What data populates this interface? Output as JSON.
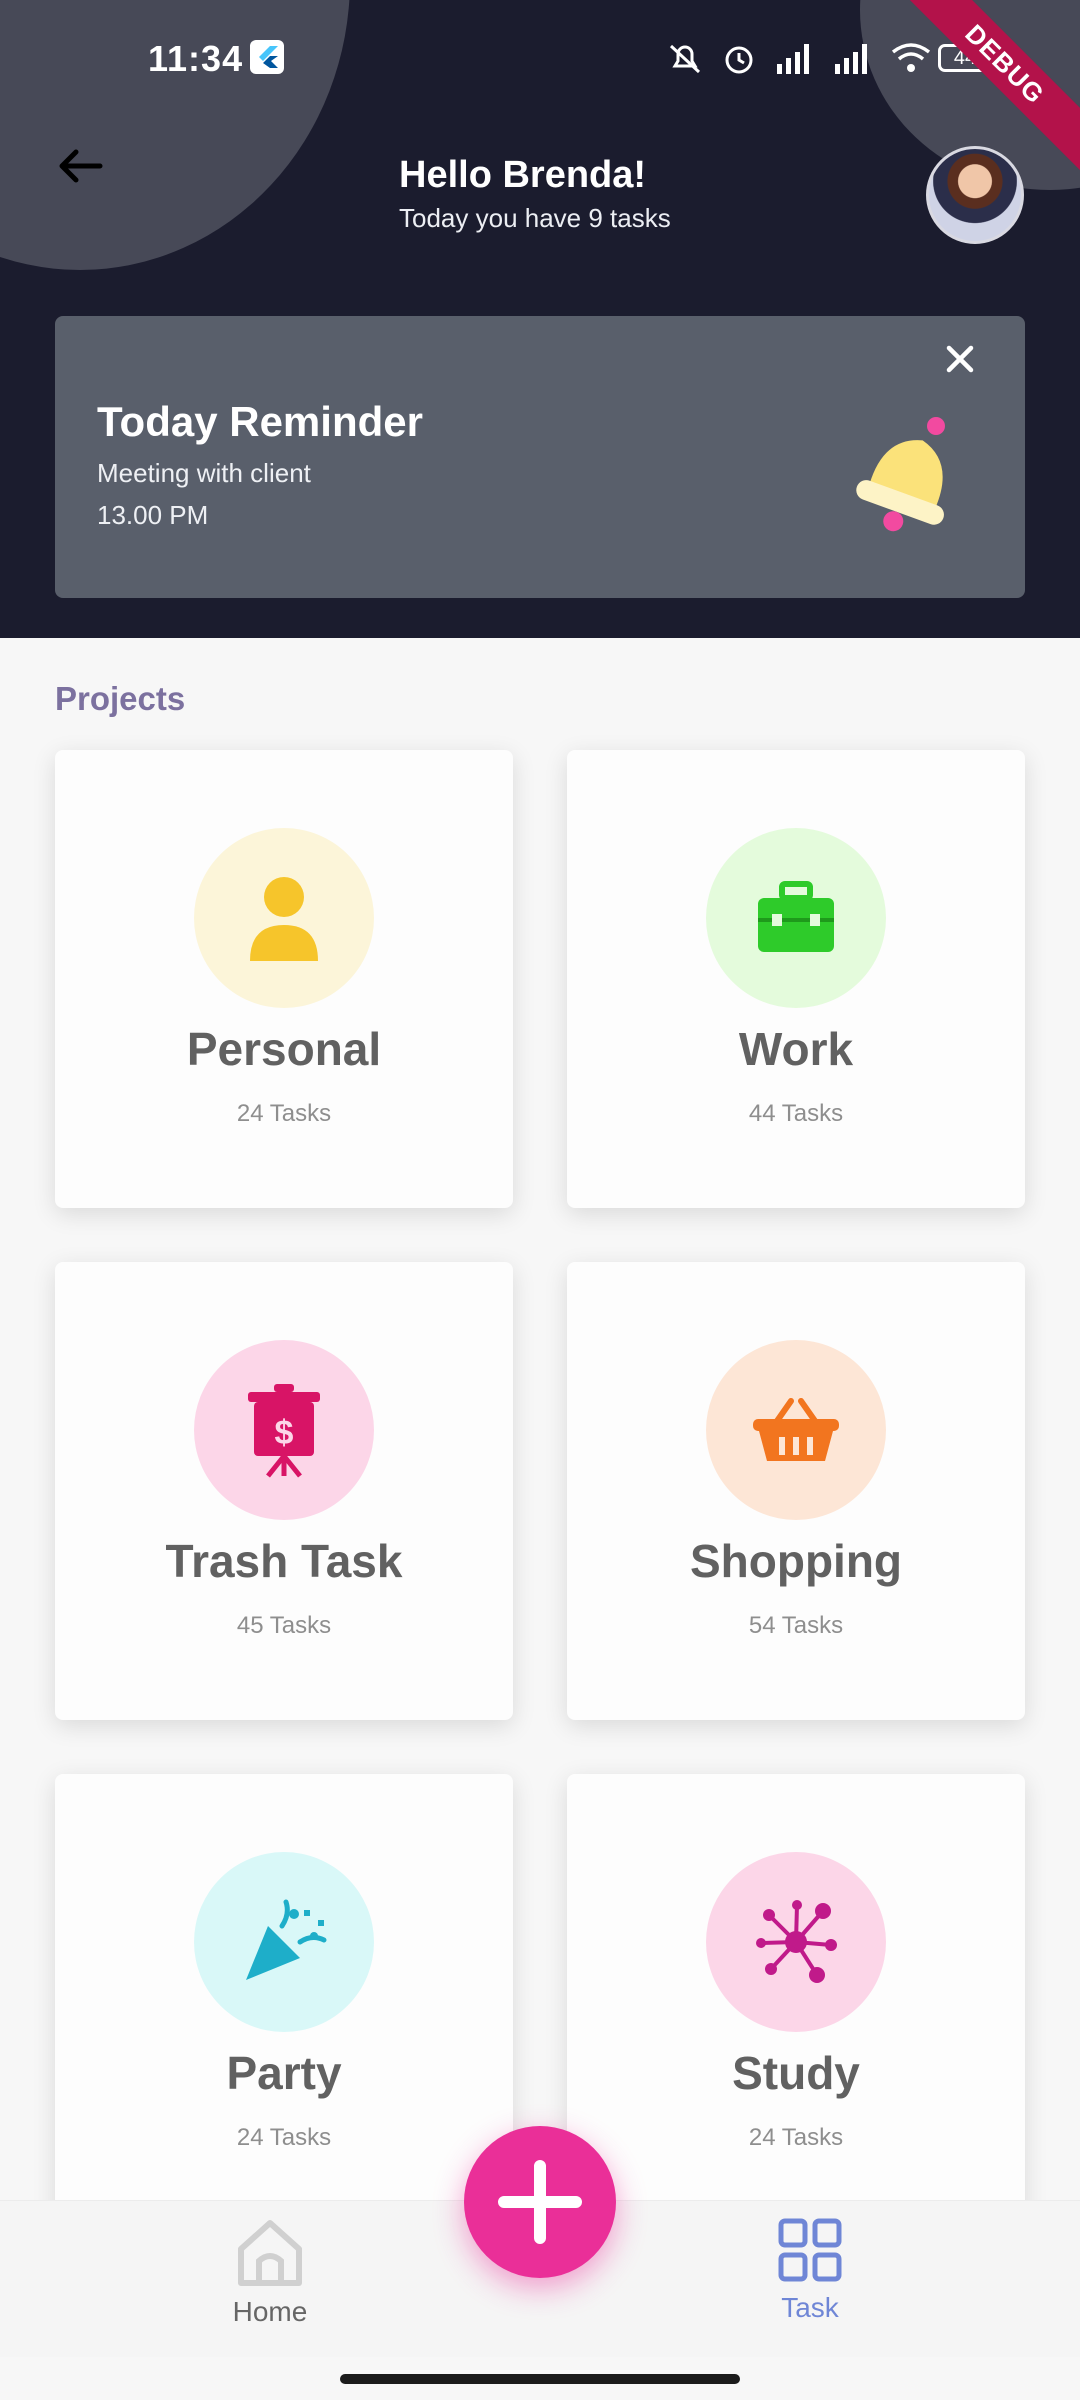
{
  "status_bar": {
    "time": "11:34",
    "battery": "44",
    "debug_banner": "DEBUG"
  },
  "header": {
    "greeting": "Hello Brenda!",
    "subtitle": "Today you have 9 tasks"
  },
  "reminder": {
    "title": "Today Reminder",
    "line1": "Meeting with client",
    "line2": "13.00 PM"
  },
  "projects": {
    "label": "Projects",
    "items": [
      {
        "name": "Personal",
        "count": "24 Tasks",
        "icon": "person-icon",
        "circle": "#fcf5d9",
        "color": "#f6c52b"
      },
      {
        "name": "Work",
        "count": "44 Tasks",
        "icon": "briefcase-icon",
        "circle": "#e4fbdc",
        "color": "#2ecb2a"
      },
      {
        "name": "Trash Task",
        "count": "45 Tasks",
        "icon": "dollar-board-icon",
        "circle": "#fcd6e8",
        "color": "#d81466"
      },
      {
        "name": "Shopping",
        "count": "54 Tasks",
        "icon": "basket-icon",
        "circle": "#fde6d6",
        "color": "#f2751f"
      },
      {
        "name": "Party",
        "count": "24 Tasks",
        "icon": "party-popper-icon",
        "circle": "#d9f8f8",
        "color": "#1eaec9"
      },
      {
        "name": "Study",
        "count": "24 Tasks",
        "icon": "molecule-icon",
        "circle": "#fcd6e8",
        "color": "#c01a8a"
      }
    ]
  },
  "bottom_nav": {
    "home_label": "Home",
    "task_label": "Task",
    "active": "Task"
  },
  "colors": {
    "header_bg": "#1b1c2e",
    "reminder_bg": "#595f6b",
    "fab": "#ea2f98",
    "accent_label": "#7c719f",
    "nav_active": "#6f86d6"
  }
}
